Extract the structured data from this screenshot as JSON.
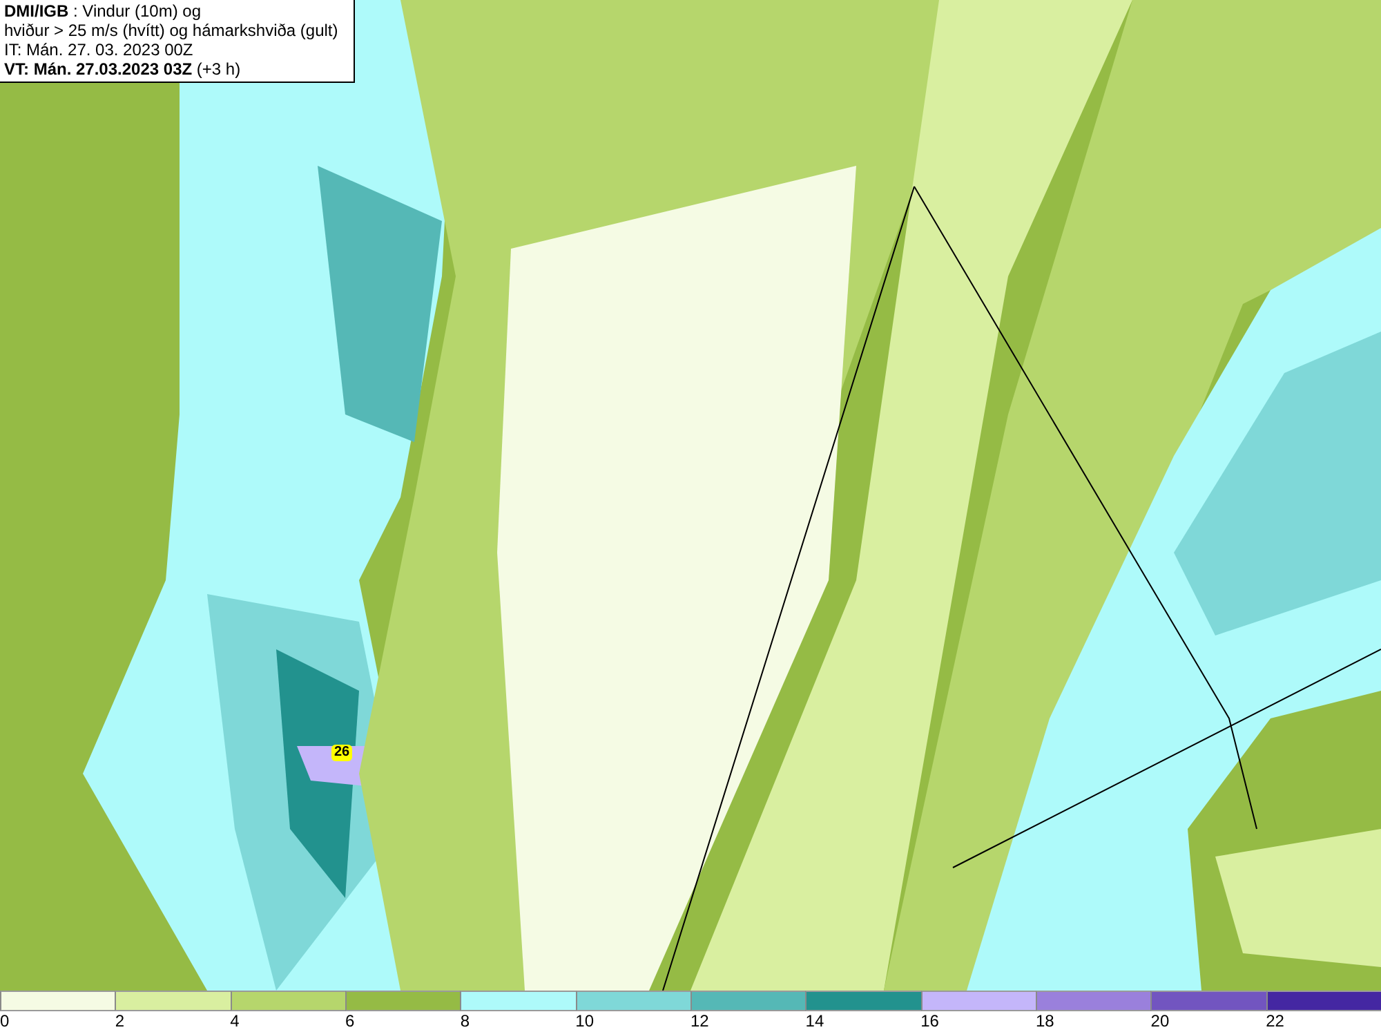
{
  "header": {
    "lines": [
      "**DMI/IGB** : Vindur (10m) og",
      "hviður > 25 m/s (hvítt) og hámarkshviða (gult)",
      "IT: Mán. 27. 03. 2023 00Z",
      "**VT: Mán. 27.03.2023 03Z** (+3 h)"
    ]
  },
  "map": {
    "markers": [
      {
        "label": "26"
      }
    ]
  },
  "legend": [
    {
      "label": "0",
      "color": "#f5fbe4"
    },
    {
      "label": "2",
      "color": "#d9efa0"
    },
    {
      "label": "4",
      "color": "#b6d66c"
    },
    {
      "label": "6",
      "color": "#95bb45"
    },
    {
      "label": "8",
      "color": "#aefafa"
    },
    {
      "label": "10",
      "color": "#7fd8d8"
    },
    {
      "label": "12",
      "color": "#55b8b6"
    },
    {
      "label": "14",
      "color": "#22928e"
    },
    {
      "label": "16",
      "color": "#c4b6fa"
    },
    {
      "label": "18",
      "color": "#9a80dc"
    },
    {
      "label": "20",
      "color": "#7255c0"
    },
    {
      "label": "22",
      "color": "#4427a2"
    }
  ]
}
